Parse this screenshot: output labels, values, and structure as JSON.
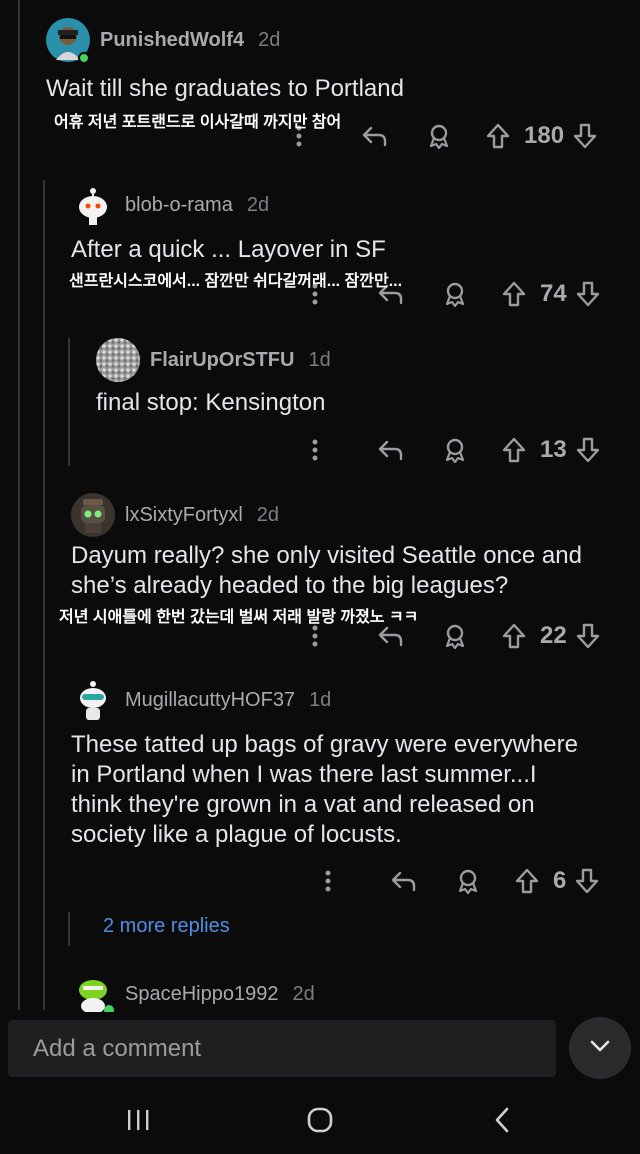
{
  "comments": [
    {
      "username": "PunishedWolf4",
      "age": "2d",
      "body": "Wait till she graduates to Portland",
      "translation": "어휴 저년 포트랜드로 이사갈때 까지만 참어",
      "votes": "180"
    },
    {
      "username": "blob-o-rama",
      "age": "2d",
      "body": "After a quick ... Layover in SF",
      "translation": "샌프란시스코에서... 잠깐만 쉬다갈꺼래... 잠깐만...",
      "votes": "74"
    },
    {
      "username": "FlairUpOrSTFU",
      "age": "1d",
      "body": "final stop: Kensington",
      "votes": "13"
    },
    {
      "username": "lxSixtyFortyxl",
      "age": "2d",
      "body_lines": [
        "Dayum really? she only visited Seattle once and",
        "she’s already headed to the big leagues?"
      ],
      "translation": "저년 시애틀에 한번 갔는데 벌써 저래 발랑 까졌노 ㅋㅋ",
      "votes": "22"
    },
    {
      "username": "MugillacuttyHOF37",
      "age": "1d",
      "body_lines": [
        "These tatted up bags of gravy were everywhere",
        "in Portland when I was there last summer...I",
        "think they're grown in a vat and released on",
        "society like a plague of locusts."
      ],
      "votes": "6"
    },
    {
      "username": "SpaceHippo1992",
      "age": "2d"
    }
  ],
  "more_replies": "2 more replies",
  "composer": {
    "placeholder": "Add a comment"
  },
  "colors": {
    "background": "#0b0b0b",
    "link": "#4f8fe0",
    "thread_line": "#343536"
  },
  "icons": [
    "more-options-icon",
    "reply-icon",
    "award-icon",
    "upvote-icon",
    "downvote-icon",
    "chevron-down-icon",
    "recent-apps-icon",
    "home-icon",
    "back-icon"
  ]
}
